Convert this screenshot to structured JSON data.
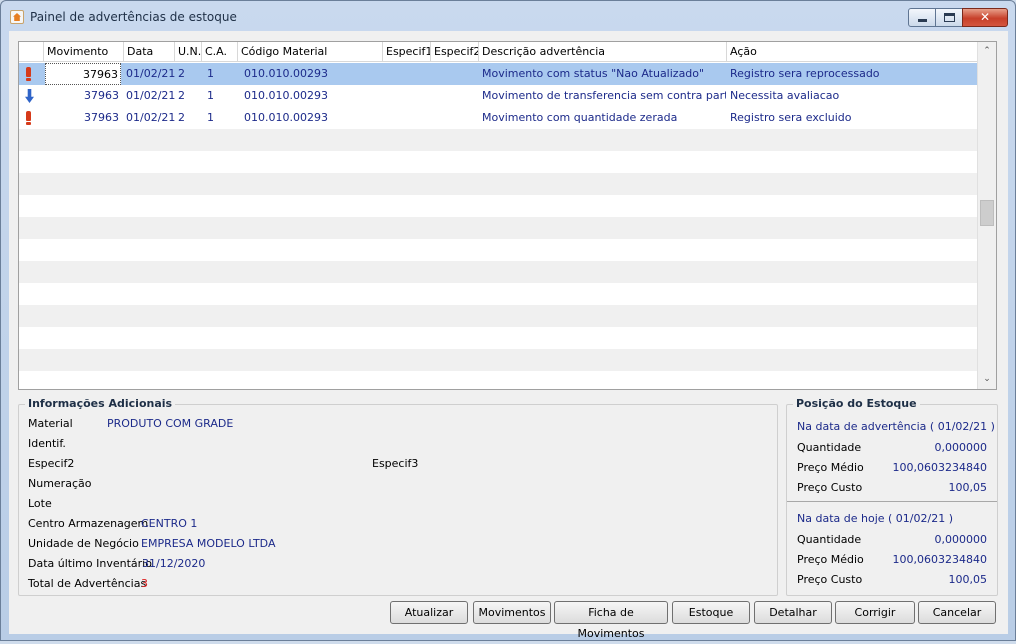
{
  "window": {
    "title": "Painel de advertências de estoque"
  },
  "grid": {
    "columns": [
      "Movimento",
      "Data",
      "U.N.",
      "C.A.",
      "Código Material",
      "Especif1",
      "Especif2",
      "Descrição advertência",
      "Ação"
    ],
    "rows": [
      {
        "icon": "warning-icon",
        "movimento": "37963",
        "data": "01/02/21",
        "un": "2",
        "ca": "1",
        "codigo": "010.010.00293",
        "especif1": "",
        "especif2": "",
        "descricao": "Movimento com status \"Nao Atualizado\"",
        "acao": "Registro sera reprocessado"
      },
      {
        "icon": "arrow-down-icon",
        "movimento": "37963",
        "data": "01/02/21",
        "un": "2",
        "ca": "1",
        "codigo": "010.010.00293",
        "especif1": "",
        "especif2": "",
        "descricao": "Movimento de transferencia sem contra partida",
        "acao": "Necessita avaliacao"
      },
      {
        "icon": "warning-icon",
        "movimento": "37963",
        "data": "01/02/21",
        "un": "2",
        "ca": "1",
        "codigo": "010.010.00293",
        "especif1": "",
        "especif2": "",
        "descricao": "Movimento com quantidade zerada",
        "acao": "Registro sera excluido"
      }
    ]
  },
  "info": {
    "title": "Informações Adicionais",
    "material_label": "Material",
    "material_value": "PRODUTO COM GRADE",
    "identif_label": "Identif.",
    "especif2_label": "Especif2",
    "especif3_label": "Especif3",
    "numeracao_label": "Numeração",
    "lote_label": "Lote",
    "centro_label": "Centro Armazenagem",
    "centro_value": "CENTRO 1",
    "unidade_label": "Unidade de Negócio",
    "unidade_value": "EMPRESA MODELO LTDA",
    "inventario_label": "Data último Inventário",
    "inventario_value": "31/12/2020",
    "total_label": "Total de Advertências",
    "total_value": "3"
  },
  "stock": {
    "title": "Posição do Estoque",
    "advert_heading": "Na data de advertência ( 01/02/21 )",
    "advert_qtd_label": "Quantidade",
    "advert_qtd": "0,000000",
    "advert_pm_label": "Preço Médio",
    "advert_pm": "100,0603234840",
    "advert_pc_label": "Preço Custo",
    "advert_pc": "100,05",
    "today_heading": "Na data de hoje ( 01/02/21 )",
    "today_qtd_label": "Quantidade",
    "today_qtd": "0,000000",
    "today_pm_label": "Preço Médio",
    "today_pm": "100,0603234840",
    "today_pc_label": "Preço Custo",
    "today_pc": "100,05"
  },
  "buttons": {
    "atualizar": "Atualizar",
    "movimentos": "Movimentos",
    "ficha": "Ficha de Movimentos",
    "estoque": "Estoque",
    "detalhar": "Detalhar",
    "corrigir": "Corrigir",
    "cancelar": "Cancelar"
  }
}
